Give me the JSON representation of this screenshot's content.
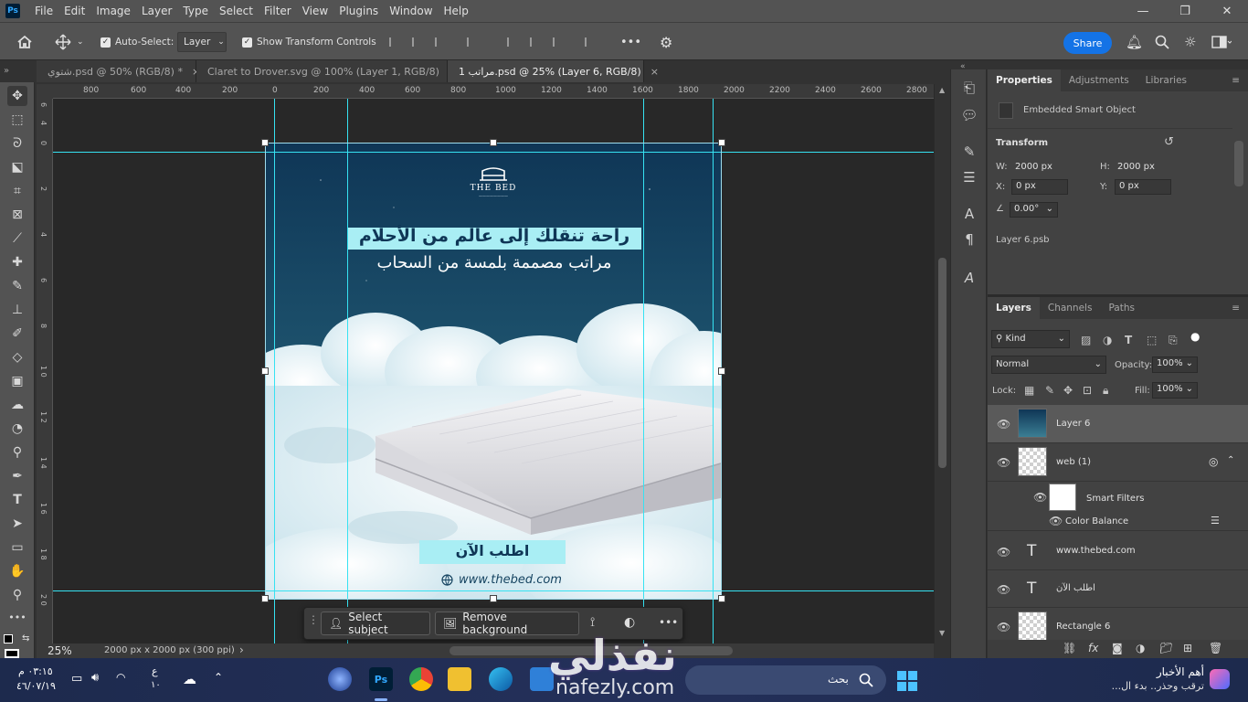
{
  "menubar": {
    "logo": "Ps",
    "items": [
      "File",
      "Edit",
      "Image",
      "Layer",
      "Type",
      "Select",
      "Filter",
      "View",
      "Plugins",
      "Window",
      "Help"
    ],
    "minimize": "—",
    "maximize": "❐",
    "close": "✕"
  },
  "options": {
    "auto_select_label": "Auto-Select:",
    "auto_select_value": "Layer",
    "show_transform_label": "Show Transform Controls",
    "more": "•••",
    "share_label": "Share"
  },
  "tabs": [
    {
      "label": "شتوي.psd @ 50% (RGB/8) *",
      "close": "×",
      "active": false
    },
    {
      "label": "Claret to Drover.svg @ 100% (Layer 1, RGB/8)",
      "close": "×",
      "active": false
    },
    {
      "label": "مراتب 1.psd @ 25% (Layer 6, RGB/8)",
      "close": "×",
      "active": true
    }
  ],
  "ruler": {
    "h": [
      "800",
      "600",
      "400",
      "200",
      "0",
      "200",
      "400",
      "600",
      "800",
      "1000",
      "1200",
      "1400",
      "1600",
      "1800",
      "2000",
      "2200",
      "2400",
      "2600",
      "2800"
    ],
    "v": [
      "6",
      "4",
      "2",
      "0",
      "2",
      "4",
      "6",
      "8",
      "1 0",
      "1 2",
      "1 4",
      "1 6",
      "1 8",
      "2 0"
    ]
  },
  "artwork": {
    "brand": "THE BED",
    "brand_sub": "————————",
    "headline": "راحة تنقلك إلى عالم من الأحلام",
    "subheadline": "مراتب مصممة بلمسة من السحاب",
    "cta": "اطلب الآن",
    "website": "www.thebed.com",
    "colors": {
      "sky_top": "#0f3656",
      "sky_bottom": "#2a6a82",
      "highlight": "#a9eef4",
      "cloud": "#e6f4f7"
    }
  },
  "ctxbar": {
    "select_subject": "Select subject",
    "remove_background": "Remove background",
    "more": "•••"
  },
  "status": {
    "zoom": "25%",
    "doc_size": "2000 px x 2000 px (300 ppi)",
    "arrow": "›"
  },
  "properties": {
    "tabs": [
      "Properties",
      "Adjustments",
      "Libraries"
    ],
    "kind": "Embedded Smart Object",
    "transform_title": "Transform",
    "w_label": "W:",
    "w_value": "2000 px",
    "h_label": "H:",
    "h_value": "2000 px",
    "x_label": "X:",
    "x_value": "0 px",
    "y_label": "Y:",
    "y_value": "0 px",
    "angle_value": "0.00°",
    "linked_file": "Layer 6.psb"
  },
  "layers": {
    "tabs": [
      "Layers",
      "Channels",
      "Paths"
    ],
    "kind_label": "Kind",
    "blend_mode": "Normal",
    "opacity_label": "Opacity:",
    "opacity_value": "100%",
    "lock_label": "Lock:",
    "fill_label": "Fill:",
    "fill_value": "100%",
    "rows": [
      {
        "name": "Layer 6",
        "type": "smart",
        "selected": true
      },
      {
        "name": "web (1)",
        "type": "smart",
        "selected": false
      },
      {
        "name": "Smart Filters",
        "type": "filter",
        "selected": false
      },
      {
        "name": "Color Balance",
        "type": "adjust",
        "selected": false
      },
      {
        "name": "www.thebed.com",
        "type": "text",
        "selected": false
      },
      {
        "name": "اطلب الآن",
        "type": "text",
        "selected": false
      },
      {
        "name": "Rectangle 6",
        "type": "shape",
        "selected": false
      }
    ],
    "text_icon": "T",
    "footer": [
      "fx"
    ]
  },
  "taskbar": {
    "time": "٠٣:١٥ م",
    "date": "٤٦/٠٧/١٩",
    "lang_top": "ع",
    "lang_bottom": "١٠",
    "search_placeholder": "بحث",
    "news_title": "أهم الأخبار",
    "news_sub": "ترقب وحذر.. بدء ال...",
    "ps_label": "Ps",
    "watermark": "نفذلي",
    "watermark_url": "nafezly.com"
  }
}
